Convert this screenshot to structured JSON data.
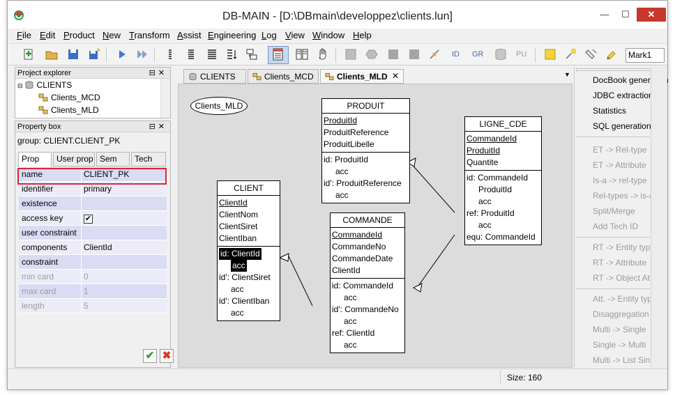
{
  "window": {
    "title": "DB-MAIN  - [D:\\DBmain\\developpez\\clients.lun]",
    "minimize": "—",
    "maximize": "☐",
    "close": "✕"
  },
  "menu": [
    "File",
    "Edit",
    "Product",
    "New",
    "Transform",
    "Assist",
    "Engineering",
    "Log",
    "View",
    "Window",
    "Help"
  ],
  "toolbar": {
    "labels": [
      "ID",
      "GR",
      "PU"
    ],
    "mark_select": "Mark1"
  },
  "project_explorer": {
    "title": "Project explorer",
    "root": "CLIENTS",
    "children": [
      "Clients_MCD",
      "Clients_MLD"
    ]
  },
  "property_box": {
    "title": "Property box",
    "group": "group: CLIENT.CLIENT_PK",
    "tabs": [
      "Prop",
      "User prop",
      "Sem",
      "Tech"
    ],
    "rows": [
      {
        "name": "name",
        "value": "CLIENT_PK"
      },
      {
        "name": "identifier",
        "value": "primary"
      },
      {
        "name": "existence",
        "value": ""
      },
      {
        "name": "access key",
        "value": "✔"
      },
      {
        "name": "user constraint",
        "value": ""
      },
      {
        "name": "components",
        "value": "ClientId"
      },
      {
        "name": "constraint",
        "value": ""
      },
      {
        "name": "min card",
        "value": "0"
      },
      {
        "name": "max card",
        "value": "1"
      },
      {
        "name": "length",
        "value": "5"
      }
    ]
  },
  "doc_tabs": [
    "CLIENTS",
    "Clients_MCD",
    "Clients_MLD"
  ],
  "diagram": {
    "schema_label": "Clients_MLD",
    "entities": {
      "produit": {
        "title": "PRODUIT",
        "attrs": [
          "ProduitId",
          "ProduitReference",
          "ProduitLibelle"
        ],
        "groups": [
          "id: ProduitId",
          "acc",
          "id': ProduitReference",
          "acc"
        ]
      },
      "ligne_cde": {
        "title": "LIGNE_CDE",
        "attrs": [
          "CommandeId",
          "ProduitId",
          "Quantite"
        ],
        "groups": [
          "id: CommandeId",
          "ProduitId",
          "acc",
          "ref: ProduitId",
          "acc",
          "equ: CommandeId"
        ]
      },
      "client": {
        "title": "CLIENT",
        "attrs": [
          "ClientId",
          "ClientNom",
          "ClientSiret",
          "ClientIban"
        ],
        "groups": [
          "id: ClientId",
          "acc",
          "id': ClientSiret",
          "acc",
          "id': ClientIban",
          "acc"
        ]
      },
      "commande": {
        "title": "COMMANDE",
        "attrs": [
          "CommandeId",
          "CommandeNo",
          "CommandeDate",
          "ClientId"
        ],
        "groups": [
          "id: CommandeId",
          "acc",
          "id': CommandeNo",
          "acc",
          "ref: ClientId",
          "acc"
        ]
      }
    }
  },
  "right_panel": {
    "active_items": [
      "DocBook generation",
      "JDBC extraction",
      "Statistics",
      "SQL generation"
    ],
    "disabled_items": [
      "ET -> Rel-type",
      "ET -> Attribute",
      "Is-a -> rel-type",
      "Rel-types -> is-a",
      "Split/Merge",
      "Add Tech ID",
      "RT -> Entity typ",
      "RT -> Attribute",
      "RT -> Object At",
      "Att. -> Entity typ",
      "Disaggregation",
      "Multi -> Single",
      "Single -> Multi",
      "Multi -> List Sin"
    ]
  },
  "status": {
    "size": "Size: 160"
  },
  "colors": {
    "selection_outline": "#d8283a",
    "row_odd": "#d9dcf3",
    "row_even": "#ececf8",
    "close_button": "#c7382b"
  }
}
